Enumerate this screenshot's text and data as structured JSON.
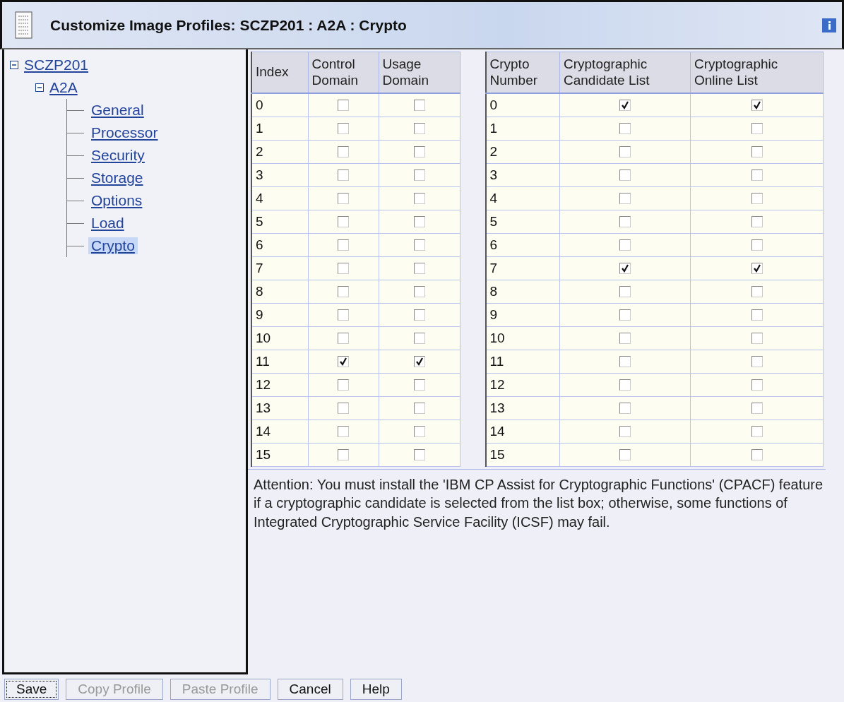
{
  "window": {
    "title": "Customize Image Profiles: SCZP201 : A2A : Crypto"
  },
  "tree": [
    {
      "label": "SCZP201",
      "expanded": true,
      "selected": false,
      "children": [
        {
          "label": "A2A",
          "expanded": true,
          "selected": false,
          "children": [
            {
              "label": "General",
              "selected": false
            },
            {
              "label": "Processor",
              "selected": false
            },
            {
              "label": "Security",
              "selected": false
            },
            {
              "label": "Storage",
              "selected": false
            },
            {
              "label": "Options",
              "selected": false
            },
            {
              "label": "Load",
              "selected": false
            },
            {
              "label": "Crypto",
              "selected": true
            }
          ]
        }
      ]
    }
  ],
  "domain_table": {
    "columns": [
      "Index",
      "Control Domain",
      "Usage Domain"
    ],
    "rows": [
      {
        "index": "0",
        "control": false,
        "usage": false
      },
      {
        "index": "1",
        "control": false,
        "usage": false
      },
      {
        "index": "2",
        "control": false,
        "usage": false
      },
      {
        "index": "3",
        "control": false,
        "usage": false
      },
      {
        "index": "4",
        "control": false,
        "usage": false
      },
      {
        "index": "5",
        "control": false,
        "usage": false
      },
      {
        "index": "6",
        "control": false,
        "usage": false
      },
      {
        "index": "7",
        "control": false,
        "usage": false
      },
      {
        "index": "8",
        "control": false,
        "usage": false
      },
      {
        "index": "9",
        "control": false,
        "usage": false
      },
      {
        "index": "10",
        "control": false,
        "usage": false
      },
      {
        "index": "11",
        "control": true,
        "usage": true
      },
      {
        "index": "12",
        "control": false,
        "usage": false
      },
      {
        "index": "13",
        "control": false,
        "usage": false
      },
      {
        "index": "14",
        "control": false,
        "usage": false
      },
      {
        "index": "15",
        "control": false,
        "usage": false
      }
    ]
  },
  "crypto_table": {
    "columns": [
      "Crypto Number",
      "Cryptographic Candidate List",
      "Cryptographic Online List"
    ],
    "rows": [
      {
        "number": "0",
        "candidate": true,
        "online": true
      },
      {
        "number": "1",
        "candidate": false,
        "online": false
      },
      {
        "number": "2",
        "candidate": false,
        "online": false
      },
      {
        "number": "3",
        "candidate": false,
        "online": false
      },
      {
        "number": "4",
        "candidate": false,
        "online": false
      },
      {
        "number": "5",
        "candidate": false,
        "online": false
      },
      {
        "number": "6",
        "candidate": false,
        "online": false
      },
      {
        "number": "7",
        "candidate": true,
        "online": true
      },
      {
        "number": "8",
        "candidate": false,
        "online": false
      },
      {
        "number": "9",
        "candidate": false,
        "online": false
      },
      {
        "number": "10",
        "candidate": false,
        "online": false
      },
      {
        "number": "11",
        "candidate": false,
        "online": false
      },
      {
        "number": "12",
        "candidate": false,
        "online": false
      },
      {
        "number": "13",
        "candidate": false,
        "online": false
      },
      {
        "number": "14",
        "candidate": false,
        "online": false
      },
      {
        "number": "15",
        "candidate": false,
        "online": false
      }
    ]
  },
  "note": "Attention: You must install the 'IBM CP Assist for Cryptographic Functions' (CPACF) feature if a cryptographic candidate is selected from the list box; otherwise, some functions of Integrated Cryptographic Service Facility (ICSF) may fail.",
  "buttons": [
    {
      "label": "Save",
      "disabled": false,
      "focused": true
    },
    {
      "label": "Copy Profile",
      "disabled": true,
      "focused": false
    },
    {
      "label": "Paste Profile",
      "disabled": true,
      "focused": false
    },
    {
      "label": "Cancel",
      "disabled": false,
      "focused": false
    },
    {
      "label": "Help",
      "disabled": false,
      "focused": false
    }
  ]
}
